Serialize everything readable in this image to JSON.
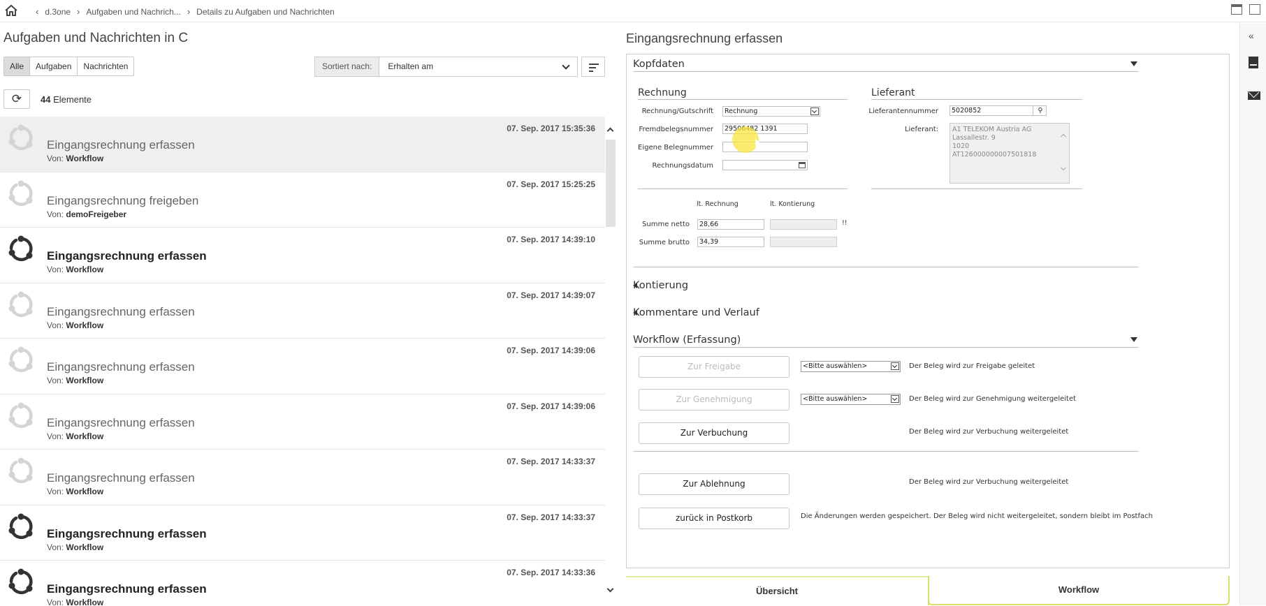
{
  "breadcrumb": {
    "items": [
      "d.3one",
      "Aufgaben und Nachrich...",
      "Details zu Aufgaben und Nachrichten"
    ]
  },
  "left": {
    "title": "Aufgaben und Nachrichten in C",
    "filters": [
      "Alle",
      "Aufgaben",
      "Nachrichten"
    ],
    "active_filter": "Alle",
    "sort_label": "Sortiert nach:",
    "sort_value": "Erhalten am",
    "count_number": "44",
    "count_label": "Elemente",
    "items": [
      {
        "title": "Eingangsrechnung erfassen",
        "from_label": "Von:",
        "from": "Workflow",
        "date": "07. Sep. 2017 15:35:36",
        "unread": false,
        "selected": true
      },
      {
        "title": "Eingangsrechnung freigeben",
        "from_label": "Von:",
        "from": "demoFreigeber",
        "date": "07. Sep. 2017 15:25:25",
        "unread": false,
        "selected": false
      },
      {
        "title": "Eingangsrechnung erfassen",
        "from_label": "Von:",
        "from": "Workflow",
        "date": "07. Sep. 2017 14:39:10",
        "unread": true,
        "selected": false
      },
      {
        "title": "Eingangsrechnung erfassen",
        "from_label": "Von:",
        "from": "Workflow",
        "date": "07. Sep. 2017 14:39:07",
        "unread": false,
        "selected": false
      },
      {
        "title": "Eingangsrechnung erfassen",
        "from_label": "Von:",
        "from": "Workflow",
        "date": "07. Sep. 2017 14:39:06",
        "unread": false,
        "selected": false
      },
      {
        "title": "Eingangsrechnung erfassen",
        "from_label": "Von:",
        "from": "Workflow",
        "date": "07. Sep. 2017 14:39:06",
        "unread": false,
        "selected": false
      },
      {
        "title": "Eingangsrechnung erfassen",
        "from_label": "Von:",
        "from": "Workflow",
        "date": "07. Sep. 2017 14:33:37",
        "unread": false,
        "selected": false
      },
      {
        "title": "Eingangsrechnung erfassen",
        "from_label": "Von:",
        "from": "Workflow",
        "date": "07. Sep. 2017 14:33:37",
        "unread": true,
        "selected": false
      },
      {
        "title": "Eingangsrechnung erfassen",
        "from_label": "Von:",
        "from": "Workflow",
        "date": "07. Sep. 2017 14:33:36",
        "unread": true,
        "selected": false
      }
    ]
  },
  "right": {
    "title": "Eingangsrechnung erfassen",
    "kopfdaten": {
      "heading": "Kopfdaten",
      "rechnung_heading": "Rechnung",
      "lieferant_heading": "Lieferant",
      "rechnung_gutschrift_label": "Rechnung/Gutschrift",
      "rechnung_gutschrift_value": "Rechnung",
      "fremdbelegsnummer_label": "Fremdbelegsnummer",
      "fremdbelegsnummer_value": "29506482 1391",
      "eigene_belegnummer_label": "Eigene Belegnummer",
      "eigene_belegnummer_value": "",
      "rechnungsdatum_label": "Rechnungsdatum",
      "rechnungsdatum_value": "",
      "lieferantennummer_label": "Lieferantennummer",
      "lieferantennummer_value": "5020852",
      "lieferant_label": "Lieferant:",
      "lieferant_value": "A1 TELEKOM Austria AG\nLassallestr. 9\n1020\nAT126000000007501818",
      "col_rechnung": "lt. Rechnung",
      "col_kontierung": "lt. Kontierung",
      "summe_netto_label": "Summe netto",
      "summe_netto_value": "28,66",
      "summe_brutto_label": "Summe brutto",
      "summe_brutto_value": "34,39",
      "warn": "!!"
    },
    "kontierung": "Kontierung",
    "kommentare": "Kommentare und Verlauf",
    "workflow": {
      "heading": "Workflow (Erfassung)",
      "placeholder": "<Bitte auswählen>",
      "zur_freigabe": "Zur Freigabe",
      "zur_freigabe_desc": "Der Beleg wird zur Freigabe geleitet",
      "zur_genehmigung": "Zur Genehmigung",
      "zur_genehmigung_desc": "Der Beleg wird zur Genehmigung weitergeleitet",
      "zur_verbuchung": "Zur Verbuchung",
      "zur_verbuchung_desc": "Der Beleg wird zur Verbuchung weitergeleitet",
      "zur_ablehnung": "Zur Ablehnung",
      "zur_ablehnung_desc": "Der Beleg wird zur Verbuchung weitergeleitet",
      "zurueck": "zurück in Postkorb",
      "zurueck_desc": "Die Änderungen werden gespeichert. Der Beleg wird nicht weitergeleitet, sondern bleibt im Postfach"
    },
    "tabs": [
      "Übersicht",
      "Workflow"
    ],
    "active_tab": "Workflow"
  }
}
